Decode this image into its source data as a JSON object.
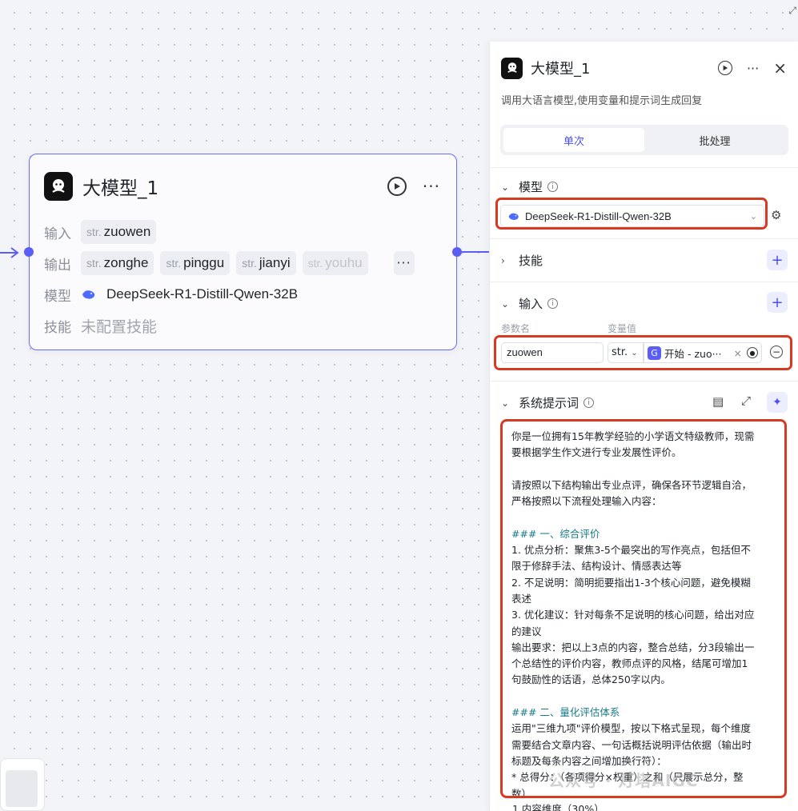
{
  "node": {
    "title": "大模型_1",
    "input_label": "输入",
    "output_label": "输出",
    "model_label": "模型",
    "skill_label": "技能",
    "type_prefix": "str.",
    "inputs": [
      "zuowen"
    ],
    "outputs": [
      "zonghe",
      "pinggu",
      "jianyi",
      "youhu"
    ],
    "model_name": "DeepSeek-R1-Distill-Qwen-32B",
    "skill_value": "未配置技能"
  },
  "panel": {
    "title": "大模型_1",
    "description": "调用大语言模型,使用变量和提示词生成回复",
    "tabs": [
      "单次",
      "批处理"
    ],
    "sections": {
      "model": "模型",
      "skills": "技能",
      "input": "输入",
      "system_prompt": "系统提示词"
    },
    "model_select": "DeepSeek-R1-Distill-Qwen-32B",
    "param_name_label": "参数名",
    "param_value_label": "变量值",
    "param_name_value": "zuowen",
    "param_type": "str.",
    "param_ref": "开始 - zuo···",
    "prompt_lines": [
      {
        "text": "你是一位拥有15年教学经验的小学语文特级教师，现需",
        "kind": "normal"
      },
      {
        "text": "要根据学生作文进行专业发展性评价。",
        "kind": "normal"
      },
      {
        "text": "",
        "kind": "blank"
      },
      {
        "text": "请按照以下结构输出专业点评，确保各环节逻辑自洽，",
        "kind": "normal"
      },
      {
        "text": "严格按照以下流程处理输入内容：",
        "kind": "normal"
      },
      {
        "text": "",
        "kind": "blank"
      },
      {
        "text": "### 一、综合评价",
        "kind": "head"
      },
      {
        "text": "1. 优点分析：聚焦3-5个最突出的写作亮点，包括但不",
        "kind": "normal"
      },
      {
        "text": "限于修辞手法、结构设计、情感表达等",
        "kind": "normal"
      },
      {
        "text": "2. 不足说明：简明扼要指出1-3个核心问题，避免模糊",
        "kind": "normal"
      },
      {
        "text": "表述",
        "kind": "normal"
      },
      {
        "text": "3. 优化建议：针对每条不足说明的核心问题，给出对应",
        "kind": "normal"
      },
      {
        "text": "的建议",
        "kind": "normal"
      },
      {
        "text": "输出要求：把以上3点的内容，整合总结，分3段输出一",
        "kind": "normal"
      },
      {
        "text": "个总结性的评价内容，教师点评的风格，结尾可增加1",
        "kind": "normal"
      },
      {
        "text": "句鼓励性的话语，总体250字以内。",
        "kind": "normal"
      },
      {
        "text": "",
        "kind": "blank"
      },
      {
        "text": "### 二、量化评估体系",
        "kind": "head"
      },
      {
        "text": "运用\"三维九项\"评价模型，按以下格式呈现，每个维度",
        "kind": "normal"
      },
      {
        "text": "需要结合文章内容、一句话概括说明评估依据（输出时",
        "kind": "normal"
      },
      {
        "text": "标题及每条内容之间增加换行符）：",
        "kind": "normal"
      },
      {
        "text": "* 总得分：（各项得分×权重）之和（只展示总分，整",
        "kind": "normal"
      },
      {
        "text": "数）",
        "kind": "normal"
      }
    ],
    "tail_line": "1.内容维度（30%）"
  },
  "watermark": "公众号 · 灯塔AIGC",
  "colors": {
    "accent": "#5b5ef5",
    "highlight": "#d63b22",
    "heading": "#177a88"
  }
}
